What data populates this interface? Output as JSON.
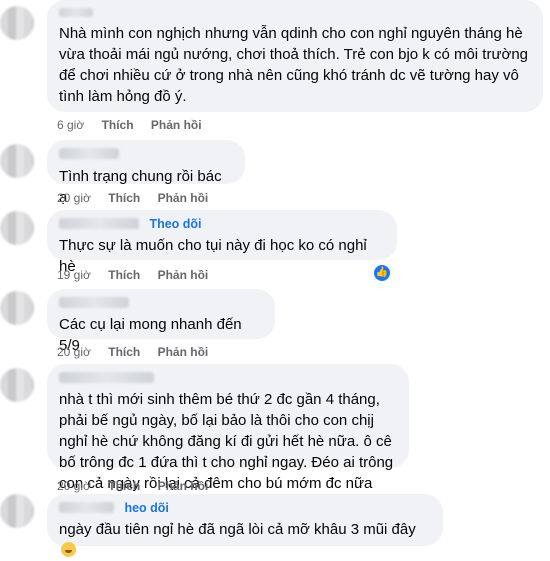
{
  "comments": [
    {
      "text": "Nhà mình con nghịch nhưng vẫn qdinh cho con nghỉ nguyên tháng hè vừa thoải mái ngủ nướng, chơi thoả thích. Trẻ con bjo k có môi trường để chơi nhiều cứ ở trong nhà nên cũng khó tránh dc vẽ tường hay vô tình làm hỏng đồ ý.",
      "time": "6 giờ",
      "like": "Thích",
      "reply": "Phản hồi"
    },
    {
      "text": "Tình trạng chung rồi bác ạ",
      "time": "20 giờ",
      "like": "Thích",
      "reply": "Phản hồi"
    },
    {
      "follow": "Theo dõi",
      "text": "Thực sự là muốn cho tụi này đi học ko có nghỉ hè",
      "time": "19 giờ",
      "like": "Thích",
      "reply": "Phản hồi"
    },
    {
      "text": "Các cụ lại mong nhanh đến 5/9",
      "time": "20 giờ",
      "like": "Thích",
      "reply": "Phản hồi"
    },
    {
      "text": "nhà t thì mới sinh thêm bé thứ 2 đc gần 4 tháng, phải bế ngủ ngày, bố lại bảo là thôi cho con chịj nghỉ hè chứ không đăng kí đi gửi hết hè nữa. ô cê bố trông đc 1 đứa thì t cho nghỉ ngay. Đéo ai trông con cả ngày rồi lại cả đêm cho bú mớm đc nữa vậy",
      "time": "20 giờ",
      "like": "Thích",
      "reply": "Phản hồi"
    },
    {
      "follow": "heo dõi",
      "text": "ngày đầu tiên ngỉ hè đã ngã lòi cả mỡ khâu 3 mũi đây",
      "emoji": "sad-face-emoji"
    }
  ],
  "colors": {
    "bubble": "#f0f2f5",
    "link": "#1b74e4",
    "meta": "#65676b"
  }
}
